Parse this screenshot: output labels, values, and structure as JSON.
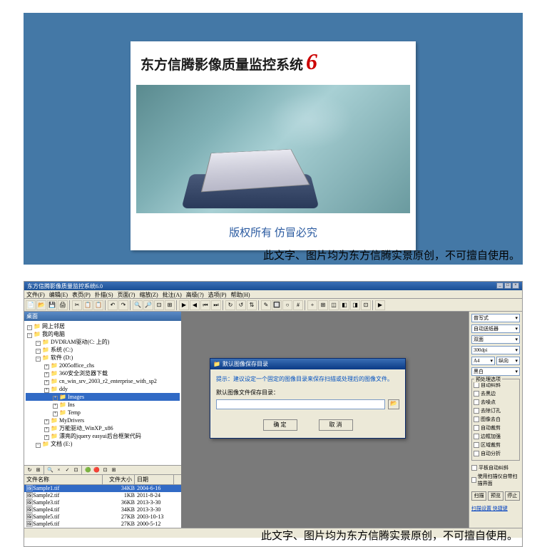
{
  "splash": {
    "title": "东方信腾影像质量监控系统",
    "version": "6",
    "copyright": "版权所有   仿冒必究"
  },
  "watermark": "此文字、图片均为东方信腾实景原创，不可擅自使用。",
  "app": {
    "title": "东方信腾影像质量监控系统6.0",
    "menu": [
      "文件(F)",
      "编辑(E)",
      "表页(P)",
      "扑描(S)",
      "页面(?)",
      "缩放(Z)",
      "批注(A)",
      "高级(?)",
      "选项(P)",
      "帮助(H)"
    ]
  },
  "tree": {
    "header": "桌面",
    "items": [
      {
        "l": 0,
        "t": "网上邻居"
      },
      {
        "l": 0,
        "t": "我的电脑"
      },
      {
        "l": 1,
        "t": "DVDRAM驱动(C: 上的)"
      },
      {
        "l": 1,
        "t": "系统 (C:)"
      },
      {
        "l": 1,
        "t": "软件 (D:)"
      },
      {
        "l": 2,
        "t": "2005office_chs"
      },
      {
        "l": 2,
        "t": "360安全浏览器下载"
      },
      {
        "l": 2,
        "t": "cn_win_srv_2003_r2_enterprise_with_sp2"
      },
      {
        "l": 2,
        "t": "ddy"
      },
      {
        "l": 3,
        "t": "Images",
        "sel": true
      },
      {
        "l": 3,
        "t": "Ins"
      },
      {
        "l": 3,
        "t": "Temp"
      },
      {
        "l": 2,
        "t": "MyDrivers"
      },
      {
        "l": 2,
        "t": "万能驱动_WinXP_x86"
      },
      {
        "l": 2,
        "t": "漂亮的jquery easyui后台框架代码"
      },
      {
        "l": 1,
        "t": "文档 (E:)"
      }
    ]
  },
  "fileHeader": {
    "name": "文件名称",
    "size": "文件大小",
    "date": "日期"
  },
  "files": [
    {
      "n": "Sample1.tif",
      "s": "34KB",
      "d": "2004-6-16",
      "sel": true
    },
    {
      "n": "Sample2.tif",
      "s": "1KB",
      "d": "2011-8-24"
    },
    {
      "n": "Sample3.tif",
      "s": "36KB",
      "d": "2013-3-30"
    },
    {
      "n": "Sample4.tif",
      "s": "34KB",
      "d": "2013-3-30"
    },
    {
      "n": "Sample5.tif",
      "s": "27KB",
      "d": "2003-10-13"
    },
    {
      "n": "Sample6.tif",
      "s": "27KB",
      "d": "2000-5-12"
    }
  ],
  "dialog": {
    "title": "默认图像保存目录",
    "hint": "提示：建议设定一个固定的图像目录来保存扫描或处理后的图像文件。",
    "label": "默认图像文件保存目录：",
    "ok": "确 定",
    "cancel": "取 消"
  },
  "rightPane": {
    "selects": [
      "普写式",
      "自动送纸器",
      "双面",
      "300dpi"
    ],
    "sizeRow": [
      "A4",
      "纵向"
    ],
    "colorSel": "黑白",
    "groupTitle": "预处理选项",
    "checks": [
      "自动纠斜",
      "去黑边",
      "去噪点",
      "去除订孔",
      "图像去白",
      "自动裁剪",
      "边框加强",
      "区域裁剪",
      "自动分折"
    ],
    "flatChk": "平板自动纠斜",
    "scanChk": "使用扫描仪自带扫描界面",
    "btns": [
      "扫描",
      "预览",
      "停止"
    ],
    "links": "扫描设置 快捷键"
  }
}
